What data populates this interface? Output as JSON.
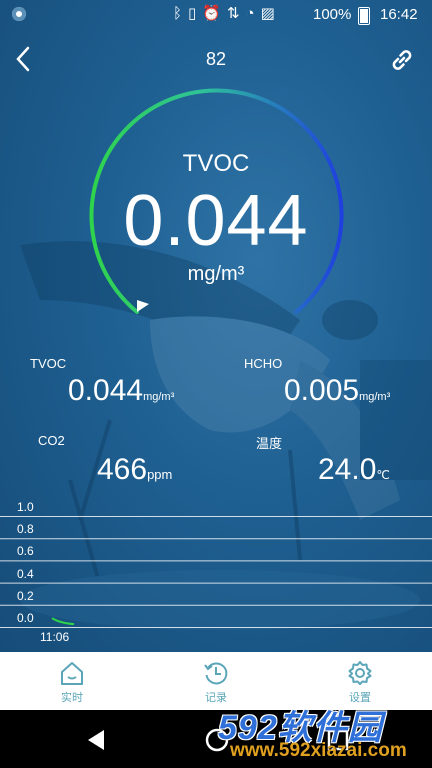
{
  "status_bar": {
    "battery_text": "100%",
    "time": "16:42",
    "icons": [
      "bluetooth-icon",
      "vibrate-icon",
      "alarm-icon",
      "data-icon",
      "wifi-icon",
      "no-sim-icon"
    ]
  },
  "header": {
    "title": "82"
  },
  "gauge": {
    "name": "TVOC",
    "value": "0.044",
    "unit": "mg/m³"
  },
  "readings": [
    {
      "label": "TVOC",
      "value": "0.044",
      "unit": "mg/m³"
    },
    {
      "label": "HCHO",
      "value": "0.005",
      "unit": "mg/m³"
    },
    {
      "label": "CO2",
      "value": "466",
      "unit": "ppm"
    },
    {
      "label": "温度",
      "value": "24.0",
      "unit": "℃"
    }
  ],
  "chart_data": {
    "type": "line",
    "yticks": [
      "1.0",
      "0.8",
      "0.6",
      "0.4",
      "0.2",
      "0.0"
    ],
    "ylim": [
      0,
      1.0
    ],
    "x": [
      "11:06"
    ],
    "series": [
      {
        "values": [
          0.044
        ]
      }
    ],
    "grid": true
  },
  "tabs": [
    {
      "label": "实时",
      "icon": "home-icon"
    },
    {
      "label": "记录",
      "icon": "history-icon"
    },
    {
      "label": "设置",
      "icon": "settings-icon"
    }
  ],
  "watermark": {
    "brand": "592软件园",
    "url": "www.592xiazai.com"
  },
  "colors": {
    "gauge_start": "#2fd44b",
    "gauge_end": "#1f3fe0",
    "tab_accent": "#5aa5b8"
  }
}
